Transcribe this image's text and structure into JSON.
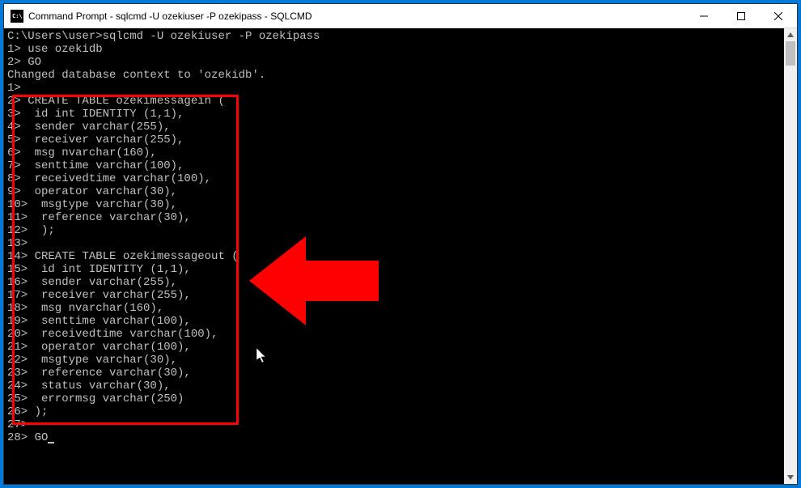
{
  "window": {
    "title": "Command Prompt - sqlcmd  -U ozekiuser -P ozekipass - SQLCMD",
    "icon_label": "CMD"
  },
  "terminal": {
    "lines": [
      "C:\\Users\\user>sqlcmd -U ozekiuser -P ozekipass",
      "1> use ozekidb",
      "2> GO",
      "Changed database context to 'ozekidb'.",
      "1>",
      "2> CREATE TABLE ozekimessagein (",
      "3>  id int IDENTITY (1,1),",
      "4>  sender varchar(255),",
      "5>  receiver varchar(255),",
      "6>  msg nvarchar(160),",
      "7>  senttime varchar(100),",
      "8>  receivedtime varchar(100),",
      "9>  operator varchar(30),",
      "10>  msgtype varchar(30),",
      "11>  reference varchar(30),",
      "12>  );",
      "13>",
      "14> CREATE TABLE ozekimessageout (",
      "15>  id int IDENTITY (1,1),",
      "16>  sender varchar(255),",
      "17>  receiver varchar(255),",
      "18>  msg nvarchar(160),",
      "19>  senttime varchar(100),",
      "20>  receivedtime varchar(100),",
      "21>  operator varchar(100),",
      "22>  msgtype varchar(30),",
      "23>  reference varchar(30),",
      "24>  status varchar(30),",
      "25>  errormsg varchar(250)",
      "26> );",
      "27>",
      "28> GO"
    ]
  },
  "controls": {
    "minimize": "─",
    "maximize": "☐",
    "close": "✕"
  }
}
